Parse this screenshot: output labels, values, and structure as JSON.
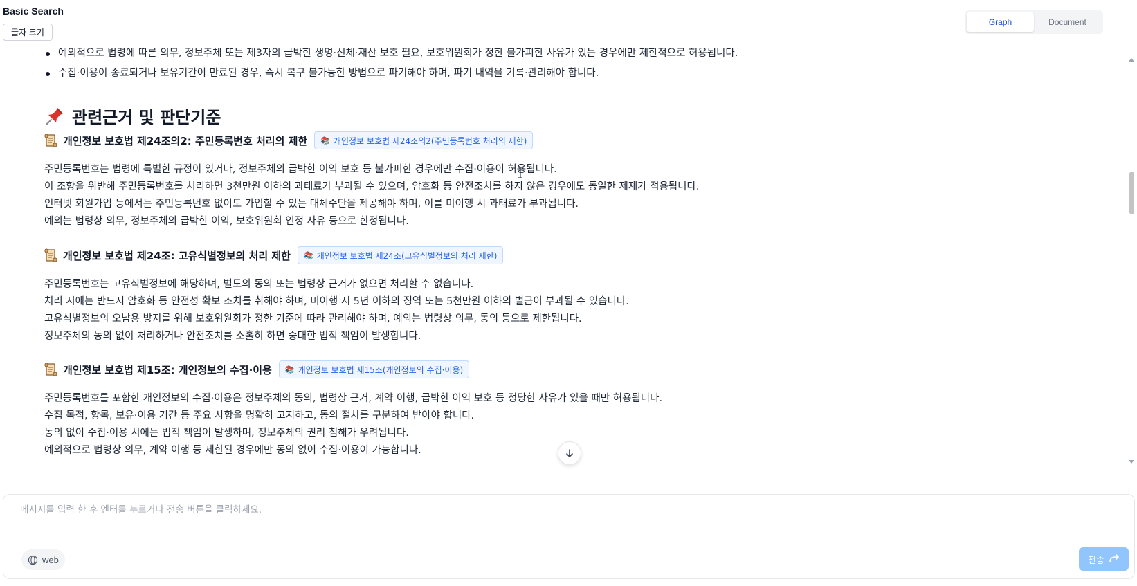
{
  "header": {
    "app_title": "Basic Search",
    "font_size_button": "글자 크기",
    "view_tabs": [
      {
        "label": "Graph",
        "active": true
      },
      {
        "label": "Document",
        "active": false
      }
    ]
  },
  "content": {
    "bullets": [
      "예외적으로 법령에 따른 의무, 정보주체 또는 제3자의 급박한 생명·신체·재산 보호 필요, 보호위원회가 정한 불가피한 사유가 있는 경우에만 제한적으로 허용됩니다.",
      "수집·이용이 종료되거나 보유기간이 만료된 경우, 즉시 복구 불가능한 방법으로 파기해야 하며, 파기 내역을 기록·관리해야 합니다."
    ],
    "section_heading": "관련근거 및 판단기준",
    "laws": [
      {
        "title": "개인정보 보호법 제24조의2: 주민등록번호 처리의 제한",
        "badge": "개인정보 보호법 제24조의2(주민등록번호 처리의 제한)",
        "paragraphs": [
          "주민등록번호는 법령에 특별한 규정이 있거나, 정보주체의 급박한 이익 보호 등 불가피한 경우에만 수집·이용이 허용됩니다.",
          "이 조항을 위반해 주민등록번호를 처리하면 3천만원 이하의 과태료가 부과될 수 있으며, 암호화 등 안전조치를 하지 않은 경우에도 동일한 제재가 적용됩니다.",
          "인터넷 회원가입 등에서는 주민등록번호 없이도 가입할 수 있는 대체수단을 제공해야 하며, 이를 미이행 시 과태료가 부과됩니다.",
          "예외는 법령상 의무, 정보주체의 급박한 이익, 보호위원회 인정 사유 등으로 한정됩니다."
        ]
      },
      {
        "title": "개인정보 보호법 제24조: 고유식별정보의 처리 제한",
        "badge": "개인정보 보호법 제24조(고유식별정보의 처리 제한)",
        "paragraphs": [
          "주민등록번호는 고유식별정보에 해당하며, 별도의 동의 또는 법령상 근거가 없으면 처리할 수 없습니다.",
          "처리 시에는 반드시 암호화 등 안전성 확보 조치를 취해야 하며, 미이행 시 5년 이하의 징역 또는 5천만원 이하의 벌금이 부과될 수 있습니다.",
          "고유식별정보의 오남용 방지를 위해 보호위원회가 정한 기준에 따라 관리해야 하며, 예외는 법령상 의무, 동의 등으로 제한됩니다.",
          "정보주체의 동의 없이 처리하거나 안전조치를 소홀히 하면 중대한 법적 책임이 발생합니다."
        ]
      },
      {
        "title": "개인정보 보호법 제15조: 개인정보의 수집·이용",
        "badge": "개인정보 보호법 제15조(개인정보의 수집·이용)",
        "paragraphs": [
          "주민등록번호를 포함한 개인정보의 수집·이용은 정보주체의 동의, 법령상 근거, 계약 이행, 급박한 이익 보호 등 정당한 사유가 있을 때만 허용됩니다.",
          "수집 목적, 항목, 보유·이용 기간 등 주요 사항을 명확히 고지하고, 동의 절차를 구분하여 받아야 합니다.",
          "동의 없이 수집·이용 시에는 법적 책임이 발생하며, 정보주체의 권리 침해가 우려됩니다.",
          "예외적으로 법령상 의무, 계약 이행 등 제한된 경우에만 동의 없이 수집·이용이 가능합니다."
        ]
      }
    ]
  },
  "chat": {
    "placeholder": "메시지를 입력 한 후 엔터를 누르거나 전송 버튼을 클릭하세요.",
    "web_chip": "web",
    "send_label": "전송"
  },
  "colors": {
    "accent": "#2563eb",
    "badge_bg": "#eff6ff",
    "send_button": "#93c5fd"
  },
  "icons": [
    "pushpin-icon",
    "scroll-icon",
    "book-icon",
    "globe-icon",
    "send-arrow-icon",
    "arrow-down-icon"
  ]
}
